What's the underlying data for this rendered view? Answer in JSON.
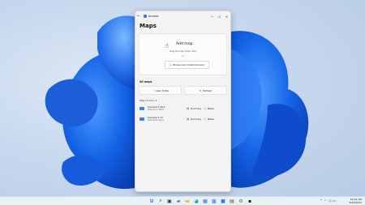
{
  "window": {
    "title": "ae.ease",
    "controls": {
      "minimize": "—",
      "maximize": "☐",
      "close": "✕"
    }
  },
  "page_title": "Maps",
  "dropzone": {
    "title": "Add map",
    "hint": "Drag the map folder here",
    "or": "or",
    "browse_label": "Browse and create manually"
  },
  "all_maps": {
    "label": "All maps",
    "open_folder": "Open folder",
    "refresh": "Refresh"
  },
  "maps_found_label": "Maps found: 2",
  "maps": [
    {
      "name": "Survival 1.20.1",
      "date": "2024-12-17 18:45",
      "summary": "Summary",
      "notes": "Notes"
    },
    {
      "name": "Survival 1.17",
      "date": "2023-06-15 22:14",
      "summary": "Summary",
      "notes": "Notes"
    }
  ],
  "taskbar": {
    "time": "10:01 AM",
    "date": "6/23/2023"
  },
  "colors": {
    "accent": "#3478f6",
    "folder": "#3b82e0",
    "bloom": "#1565e0"
  },
  "icons": [
    "windows-start-icon",
    "search-icon",
    "task-view-icon",
    "chat-icon",
    "file-explorer-icon",
    "edge-icon",
    "store-icon",
    "photos-icon",
    "app-icon",
    "notepad-icon",
    "settings-icon",
    "terminal-icon"
  ]
}
